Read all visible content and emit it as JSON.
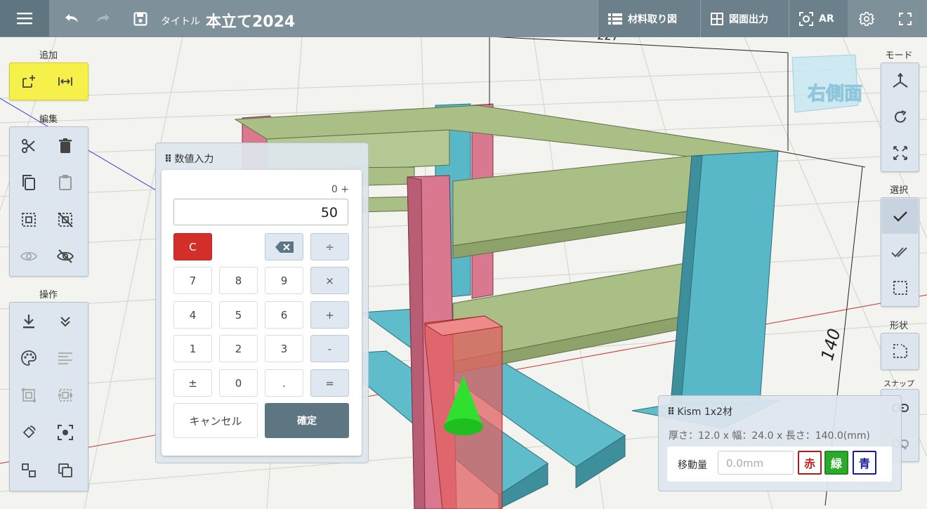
{
  "header": {
    "doc_label": "タイトル",
    "doc_title": "本立て2024",
    "buttons": {
      "cut_list": "材料取り図",
      "drawing_output": "図面出力",
      "ar": "AR"
    }
  },
  "left_panel": {
    "groups": {
      "add": "追加",
      "edit": "編集",
      "operation": "操作"
    }
  },
  "right_panel": {
    "groups": {
      "mode": "モード",
      "select": "選択",
      "shape": "形状",
      "snap": "スナップ"
    }
  },
  "calculator": {
    "title": "数値入力",
    "memo": "0 +",
    "display_value": "50",
    "keys": {
      "clear": "C",
      "div": "÷",
      "k7": "7",
      "k8": "8",
      "k9": "9",
      "mul": "×",
      "k4": "4",
      "k5": "5",
      "k6": "6",
      "plus": "+",
      "k1": "1",
      "k2": "2",
      "k3": "3",
      "minus": "-",
      "sign": "±",
      "k0": "0",
      "dot": ".",
      "equals": "="
    },
    "cancel": "キャンセル",
    "confirm": "確定"
  },
  "part_info": {
    "name": "Kism 1x2材",
    "dimensions": "厚さ：12.0 x 幅：24.0 x 長さ：140.0(mm)",
    "move_label": "移動量",
    "move_placeholder": "0.0mm",
    "axis_red": "赤",
    "axis_green": "緑",
    "axis_blue": "青"
  },
  "viewport": {
    "dimension_top": "227",
    "dimension_right": "140",
    "view_cube_face": "右側面"
  },
  "colors": {
    "toolbar": "#7e909a",
    "highlight_group": "#f6f04a",
    "part_green": "#a9bf86",
    "part_cyan": "#58b8c8",
    "part_pink": "#d9788f",
    "selected_red": "#e06060"
  }
}
